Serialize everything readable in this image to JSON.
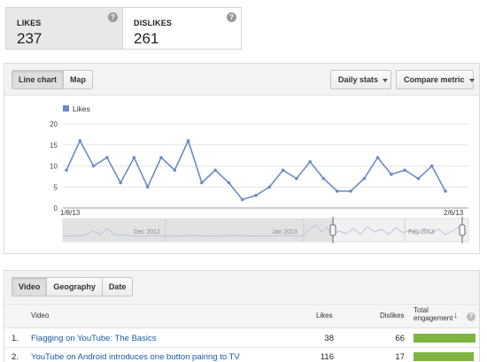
{
  "metrics": [
    {
      "label": "LIKES",
      "value": "237"
    },
    {
      "label": "DISLIKES",
      "value": "261"
    }
  ],
  "chart_toolbar": {
    "view_tabs": [
      "Line chart",
      "Map"
    ],
    "daily_stats": "Daily stats",
    "compare_metric": "Compare metric"
  },
  "chart_data": {
    "type": "line",
    "legend": "Likes",
    "color": "#6b8ac9",
    "x_start_label": "1/8/13",
    "x_end_label": "2/6/13",
    "ylim": [
      0,
      20
    ],
    "yticks": [
      "0",
      "5",
      "10",
      "15",
      "20"
    ],
    "series": [
      {
        "name": "Likes",
        "values": [
          9,
          16,
          10,
          12,
          6,
          12,
          5,
          12,
          9,
          16,
          6,
          9,
          6,
          2,
          3,
          5,
          9,
          7,
          11,
          7,
          4,
          4,
          7,
          12,
          8,
          9,
          7,
          10,
          4
        ]
      }
    ],
    "navigator_labels": [
      "Dec 2012",
      "Jan 2013",
      "Feb 2013"
    ]
  },
  "table": {
    "tabs": [
      "Video",
      "Geography",
      "Date"
    ],
    "headers": {
      "video": "Video",
      "likes": "Likes",
      "dislikes": "Dislikes",
      "engagement": "Total engagement"
    },
    "rows": [
      {
        "rank": "1.",
        "title": "Flagging on YouTube: The Basics",
        "likes": "38",
        "dislikes": "66",
        "engagement": 1.0
      },
      {
        "rank": "2.",
        "title": "YouTube on Android introduces one button pairing to TV",
        "likes": "116",
        "dislikes": "17",
        "engagement": 0.97
      }
    ]
  }
}
